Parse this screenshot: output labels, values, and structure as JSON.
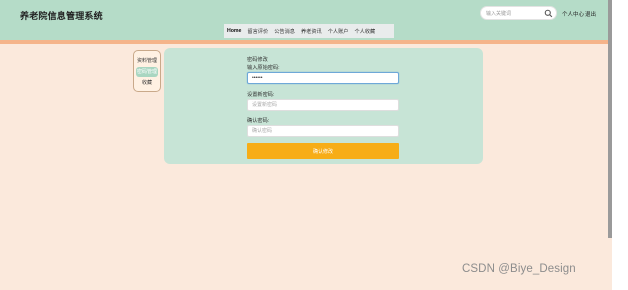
{
  "header": {
    "title": "养老院信息管理系统",
    "search": {
      "placeholder": "输入关键词",
      "value": ""
    },
    "links": {
      "personal_center": "个人中心",
      "logout": "退出"
    }
  },
  "nav": {
    "items": [
      {
        "label": "Home",
        "active": true
      },
      {
        "label": "留言评价",
        "active": false
      },
      {
        "label": "公告消息",
        "active": false
      },
      {
        "label": "养老资讯",
        "active": false
      },
      {
        "label": "个人账户",
        "active": false
      },
      {
        "label": "个人收藏",
        "active": false
      }
    ]
  },
  "sidebar": {
    "items": [
      {
        "label": "资料管理",
        "active": false
      },
      {
        "label": "密码管理",
        "active": true
      },
      {
        "label": "收藏",
        "active": false
      }
    ]
  },
  "form": {
    "title": "密码修改",
    "old_password": {
      "label": "输入原始密码:",
      "value": "••••••"
    },
    "new_password": {
      "label": "设置新密码:",
      "placeholder": "设置新密码"
    },
    "confirm_password": {
      "label": "确认密码:",
      "placeholder": "确认密码"
    },
    "submit_label": "确认修改"
  },
  "watermark": "CSDN @Biye_Design",
  "colors": {
    "header_bg": "#b5dcc8",
    "page_bg": "#fbe9dc",
    "panel_bg": "#c7e4d6",
    "accent_strip": "#f5b48a",
    "submit_button": "#f7ad17",
    "sidebar_active": "#a9d6c1"
  }
}
